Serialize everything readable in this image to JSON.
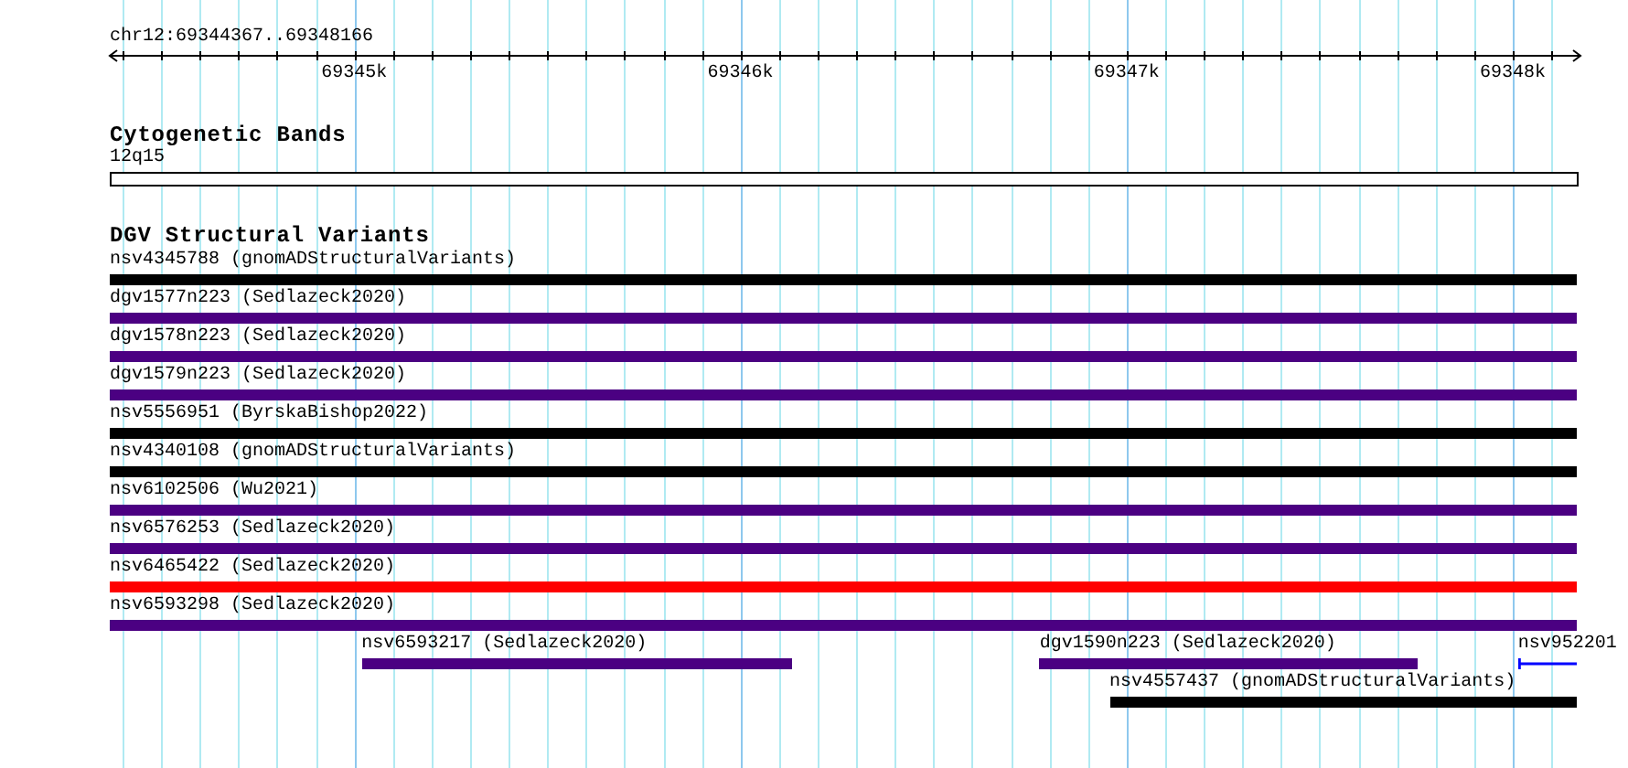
{
  "ruler": {
    "position_label": "chr12:69344367..69348166",
    "ticks": [
      {
        "label": "69345k"
      },
      {
        "label": "69346k"
      },
      {
        "label": "69347k"
      },
      {
        "label": "69348k"
      }
    ]
  },
  "tracks": [
    {
      "kind": "bands",
      "title": "Cytogenetic Bands",
      "bands": [
        {
          "label": "12q15"
        }
      ]
    },
    {
      "kind": "features",
      "title": "DGV Structural Variants",
      "features": [
        {
          "kind": "bar",
          "label": "nsv4345788 (gnomADStructuralVariants)",
          "color": "#000000"
        },
        {
          "kind": "bar",
          "label": "dgv1577n223 (Sedlazeck2020)",
          "color": "#4b0082"
        },
        {
          "kind": "bar",
          "label": "dgv1578n223 (Sedlazeck2020)",
          "color": "#4b0082"
        },
        {
          "kind": "bar",
          "label": "dgv1579n223 (Sedlazeck2020)",
          "color": "#4b0082"
        },
        {
          "kind": "bar",
          "label": "nsv5556951 (ByrskaBishop2022)",
          "color": "#000000"
        },
        {
          "kind": "bar",
          "label": "nsv4340108 (gnomADStructuralVariants)",
          "color": "#000000"
        },
        {
          "kind": "bar",
          "label": "nsv6102506 (Wu2021)",
          "color": "#4b0082"
        },
        {
          "kind": "bar",
          "label": "nsv6576253 (Sedlazeck2020)",
          "color": "#4b0082"
        },
        {
          "kind": "bar",
          "label": "nsv6465422 (Sedlazeck2020)",
          "color": "#ff0000"
        },
        {
          "kind": "bar",
          "label": "nsv6593298 (Sedlazeck2020)",
          "color": "#4b0082"
        },
        {
          "kind": "bar",
          "label": "nsv6593217 (Sedlazeck2020)",
          "color": "#4b0082"
        },
        {
          "kind": "bar",
          "label": "dgv1590n223 (Sedlazeck2020)",
          "color": "#4b0082"
        },
        {
          "kind": "line",
          "label": "nsv952201",
          "color": "#0000ff"
        },
        {
          "kind": "bar",
          "label": "nsv4557437 (gnomADStructuralVariants)",
          "color": "#000000"
        }
      ]
    }
  ]
}
